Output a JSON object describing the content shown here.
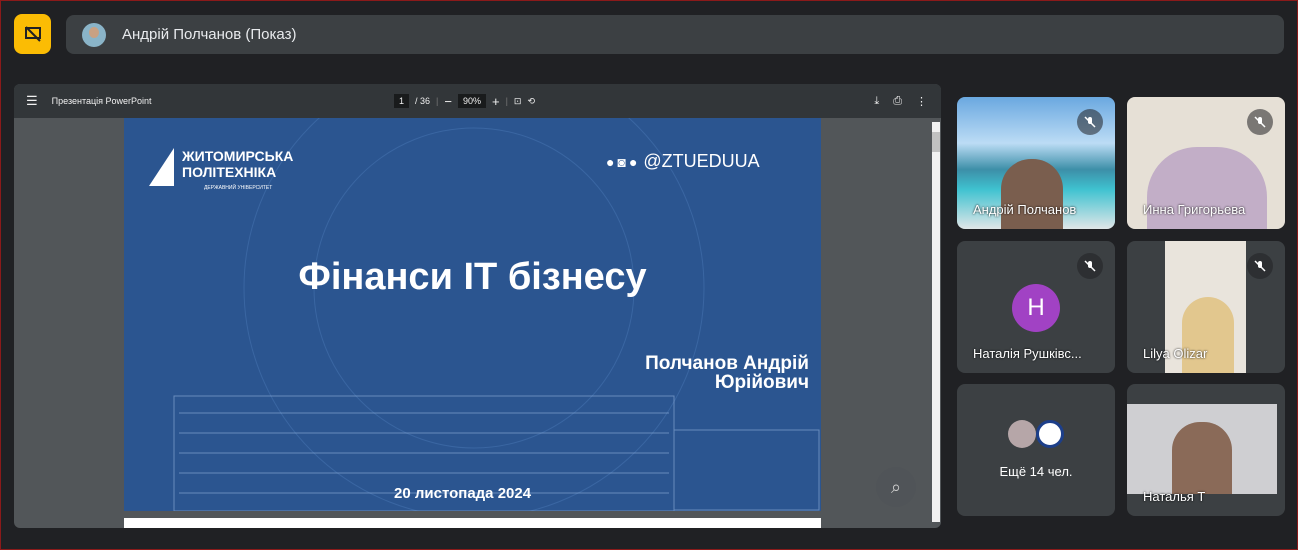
{
  "top": {
    "presenter_label": "Андрій Полчанов (Показ)"
  },
  "pdf": {
    "title": "Презентація PowerPoint",
    "page_current": "1",
    "page_total": "/ 36",
    "zoom": "90%"
  },
  "slide": {
    "logo_line1": "ЖИТОМИРСЬКА",
    "logo_line2": "ПОЛІТЕХНІКА",
    "logo_line3": "ДЕРЖАВНИЙ УНІВЕРСИТЕТ",
    "social_handle": "@ZTUEDUUA",
    "title": "Фінанси IT бізнесу",
    "author_line1": "Полчанов Андрій",
    "author_line2": "Юрійович",
    "date": "20 листопада 2024"
  },
  "participants": [
    {
      "name": "Андрій Полчанов"
    },
    {
      "name": "Инна Григорьева"
    },
    {
      "name": "Наталія Рушківс...",
      "initial": "Н",
      "avatar_color": "#a142c4"
    },
    {
      "name": "Lilya Olizar"
    },
    {
      "name": "Ещё 14 чел."
    },
    {
      "name": "Наталья Т"
    }
  ]
}
